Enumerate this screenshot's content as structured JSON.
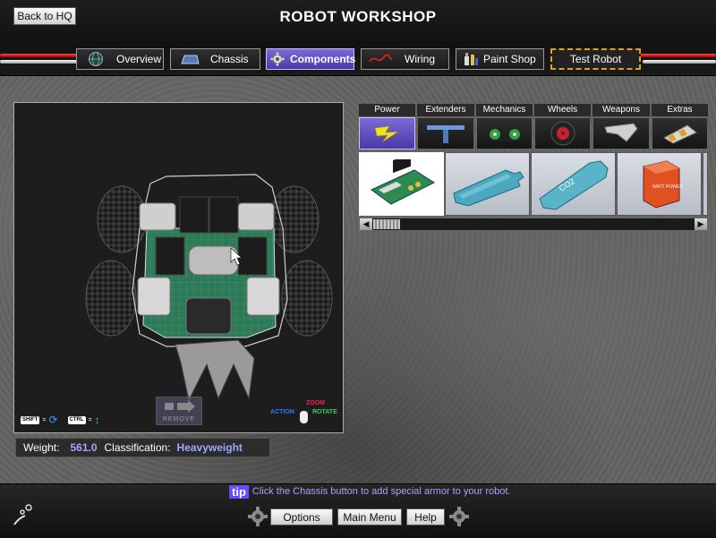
{
  "header": {
    "back_label": "Back to HQ",
    "title": "ROBOT WORKSHOP"
  },
  "tabs": [
    {
      "label": "Overview",
      "icon": "globe-icon",
      "active": false
    },
    {
      "label": "Chassis",
      "icon": "chassis-icon",
      "active": false
    },
    {
      "label": "Components",
      "icon": "gear-icon",
      "active": true
    },
    {
      "label": "Wiring",
      "icon": "wire-icon",
      "active": false
    },
    {
      "label": "Paint Shop",
      "icon": "paint-icon",
      "active": false
    },
    {
      "label": "Test Robot",
      "icon": "",
      "active": false
    }
  ],
  "viewport": {
    "shift_key": "SHIFT",
    "ctrl_key": "CTRL",
    "remove_label": "REMOVE",
    "mouse_zoom": "ZOOM",
    "mouse_action": "ACTION",
    "mouse_rotate": "ROTATE"
  },
  "stats": {
    "weight_label": "Weight:",
    "weight_value": "561.0",
    "class_label": "Classification:",
    "class_value": "Heavyweight"
  },
  "parts_panel": {
    "categories": [
      {
        "label": "Power",
        "icon": "lightning-icon",
        "active": true
      },
      {
        "label": "Extenders",
        "icon": "t-bar-icon",
        "active": false
      },
      {
        "label": "Mechanics",
        "icon": "chain-drive-icon",
        "active": false
      },
      {
        "label": "Wheels",
        "icon": "wheel-icon",
        "active": false
      },
      {
        "label": "Weapons",
        "icon": "blade-icon",
        "active": false
      },
      {
        "label": "Extras",
        "icon": "hazard-plate-icon",
        "active": false
      }
    ],
    "items": [
      {
        "icon": "circuit-board-icon",
        "selected": true
      },
      {
        "icon": "gas-tank-icon",
        "selected": false,
        "label": ""
      },
      {
        "icon": "co2-tank-icon",
        "selected": false,
        "label": "CO2"
      },
      {
        "icon": "battery-icon",
        "selected": false,
        "label": "WATT POWER"
      }
    ]
  },
  "tip": {
    "tag": "tip",
    "text": "Click the Chassis button to add special armor to your robot."
  },
  "bottom_menu": {
    "options_label": "Options",
    "main_menu_label": "Main Menu",
    "help_label": "Help"
  },
  "colors": {
    "accent": "#5a4ac0",
    "value_text": "#9fa8ff",
    "tip_text": "#a3a3ff"
  }
}
